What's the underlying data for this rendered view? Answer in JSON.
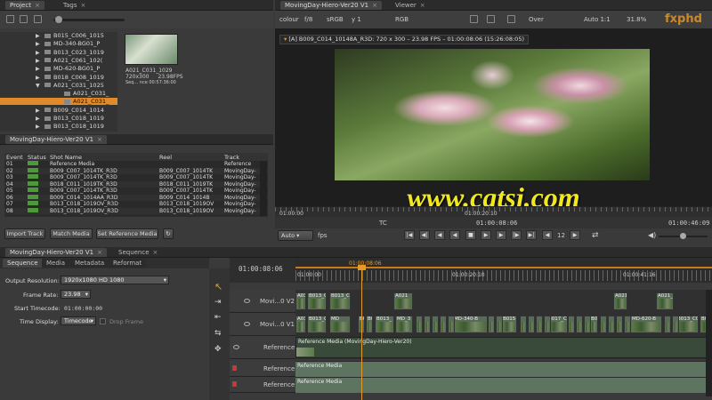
{
  "watermark": {
    "url": "www.cgtsj.com",
    "logo": "fxphd"
  },
  "project_panel": {
    "tabs": [
      "Project",
      "Tags"
    ],
    "tree": [
      {
        "label": "B015_C006_1015",
        "sel": false
      },
      {
        "label": "MD-340-BG01_P",
        "sel": false
      },
      {
        "label": "B013_C023_1019",
        "sel": false
      },
      {
        "label": "A021_C061_102(",
        "sel": false
      },
      {
        "label": "MD-620-BG01_P",
        "sel": false
      },
      {
        "label": "B018_C008_1019",
        "sel": false
      },
      {
        "label": "A021_C031_1025",
        "sel": false
      },
      {
        "label": "A021_C031_",
        "sel": false
      },
      {
        "label": "A021_C031_",
        "sel": true
      },
      {
        "label": "B009_C014_1014",
        "sel": false
      },
      {
        "label": "B013_C018_1019",
        "sel": false
      },
      {
        "label": "B013_C018_1019",
        "sel": false
      }
    ],
    "thumb": {
      "name": "A021_C031_1029",
      "res": "720x300",
      "fps": "23.98FPS",
      "seq": "Seq... nce 00:57:36:00"
    }
  },
  "sequence_panel": {
    "tab": "MovingDay-Hiero-Ver20 V1",
    "columns": [
      "Event",
      "Status",
      "Shot Name",
      "Reel",
      "Track"
    ],
    "rows": [
      {
        "event": "01",
        "shot": "Reference Media",
        "reel": "",
        "track": "Reference"
      },
      {
        "event": "02",
        "shot": "B009_C007_1014TK_R3D",
        "reel": "B009_C007_1014TK",
        "track": "MovingDay-"
      },
      {
        "event": "03",
        "shot": "B009_C007_1014TK_R3D",
        "reel": "B009_C007_1014TK",
        "track": "MovingDay-"
      },
      {
        "event": "04",
        "shot": "B018_C011_1019TK_R3D",
        "reel": "B018_C011_1019TK",
        "track": "MovingDay-"
      },
      {
        "event": "05",
        "shot": "B009_C007_1014TK_R3D",
        "reel": "B009_C007_1014TK",
        "track": "MovingDay-"
      },
      {
        "event": "06",
        "shot": "B009_C014_1014AA_R3D",
        "reel": "B009_C014_1014B",
        "track": "MovingDay-"
      },
      {
        "event": "07",
        "shot": "B013_C018_1019OV_R3D",
        "reel": "B013_C018_1019OV",
        "track": "MovingDay-"
      },
      {
        "event": "08",
        "shot": "B013_C018_1019OV_R3D",
        "reel": "B013_C018_1019OV",
        "track": "MovingDay-"
      }
    ],
    "buttons": {
      "import": "Import Track",
      "match": "Match Media",
      "ref": "Set Reference Media"
    }
  },
  "viewer": {
    "tabs": [
      "MovingDay-Hiero-Ver20 V1",
      "Viewer"
    ],
    "toolbar": {
      "channel": "colour",
      "fstop": "f/8",
      "lut": "sRGB",
      "gamma": "y 1",
      "space": "RGB",
      "composite": "Over",
      "zoom_mode": "Auto 1:1",
      "zoom": "31.8%"
    },
    "info": "[A] B009_C014_10148A_R3D: 720 x 300 – 23.98 FPS – 01:00:08:06 (15:26:08:05)",
    "ruler": {
      "start": "01:00:00",
      "mark": "01:00:20:10"
    },
    "tc_label": "TC",
    "timecode": "01:00:08:06",
    "duration": "01:00:46:09",
    "fps_mode": "Auto",
    "fps_label": "fps",
    "frame_step": "12"
  },
  "inspector": {
    "tabs": [
      "Sequence",
      "Media",
      "Metadata",
      "Reformat"
    ],
    "output_res_label": "Output Resolution:",
    "output_res": "1920x1080 HD 1080",
    "frame_rate_label": "Frame Rate:",
    "frame_rate": "23.98",
    "start_tc_label": "Start Timecode:",
    "start_tc": "01:00:00:00",
    "time_display_label": "Time Display:",
    "time_display": "Timecode",
    "drop_frame": "Drop Frame"
  },
  "timeline": {
    "tabs": [
      "MovingDay-Hiero-Ver20 V1",
      "Sequence"
    ],
    "current": "01:00:08:06",
    "ruler": [
      "01:00:00",
      "01:00:08:06",
      "01:00:20:10",
      "01:00:41:16"
    ],
    "tracks": [
      {
        "name": "Movi...0 V2"
      },
      {
        "name": "Movi...0 V1"
      },
      {
        "name": "Reference"
      },
      {
        "name": "Reference"
      },
      {
        "name": "Reference"
      }
    ],
    "v2_clips": [
      "A03",
      "B013_C",
      "B013_C0",
      "A021",
      "A021_C",
      "A021_C"
    ],
    "v1_clips": [
      "A03",
      "B013_C",
      "MD",
      "B0",
      "B0",
      "B013_",
      "MD_3",
      "MD-340-B",
      "B015",
      "B017_C",
      "B0",
      "MD-620-B",
      "B013_C018",
      "B015_C006_1015"
    ],
    "ref_clip": "Reference Media (MovingDay-Hiero-Ver20)",
    "audio_clip": "Reference Media"
  }
}
